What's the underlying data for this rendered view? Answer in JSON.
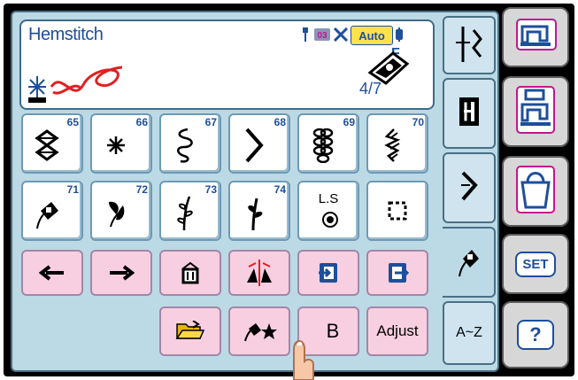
{
  "status": {
    "title": "Hemstitch",
    "auto_label": "Auto",
    "foot_letter": "F",
    "page": "4/7"
  },
  "stitches": [
    {
      "num": "65",
      "icon": "stitch-65-icon"
    },
    {
      "num": "66",
      "icon": "stitch-66-icon"
    },
    {
      "num": "67",
      "icon": "stitch-67-icon"
    },
    {
      "num": "68",
      "icon": "stitch-68-icon"
    },
    {
      "num": "69",
      "icon": "stitch-69-icon"
    },
    {
      "num": "70",
      "icon": "stitch-70-icon"
    },
    {
      "num": "71",
      "icon": "stitch-71-icon"
    },
    {
      "num": "72",
      "icon": "stitch-72-icon"
    },
    {
      "num": "73",
      "icon": "stitch-73-icon"
    },
    {
      "num": "74",
      "icon": "stitch-74-icon"
    }
  ],
  "ls_button": {
    "label": "L.S"
  },
  "bottom_row": {
    "b_label": "B",
    "adjust_label": "Adjust"
  },
  "tabs": {
    "az_label": "A~Z"
  },
  "side": {
    "set_label": "SET",
    "help_label": "?"
  },
  "colors": {
    "accent": "#1d4f9c",
    "pink": "#f8cfe0",
    "panel": "#bcd9e6",
    "magenta": "#c0188f"
  }
}
